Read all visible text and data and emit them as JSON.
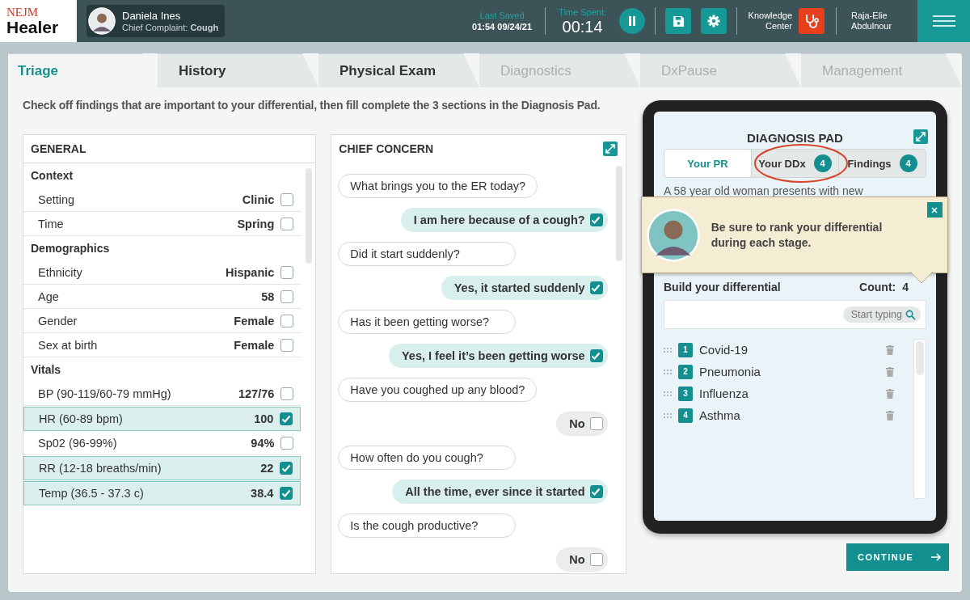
{
  "header": {
    "logo_top": "NEJM",
    "logo_bottom": "Healer",
    "patient": {
      "name": "Daniela Ines",
      "complaint": "Chief Complaint: **Cough**"
    },
    "last_saved": {
      "label": "Last Saved",
      "value": "01:54 09/24/21"
    },
    "time_spent": {
      "label": "Time Spent:",
      "value": "00:14"
    },
    "knowledge_center": "Knowledge Center",
    "user": "Raja-Elie Abdulnour"
  },
  "tabs": [
    {
      "label": "Triage",
      "selected": true,
      "disabled": false
    },
    {
      "label": "History",
      "selected": false,
      "disabled": false
    },
    {
      "label": "Physical Exam",
      "selected": false,
      "disabled": false
    },
    {
      "label": "Diagnostics",
      "selected": false,
      "disabled": true
    },
    {
      "label": "DxPause",
      "selected": false,
      "disabled": true
    },
    {
      "label": "Management",
      "selected": false,
      "disabled": true
    }
  ],
  "instruction": "Check off findings that are important to your differential, then fill complete the 3 sections in the Diagnosis Pad.",
  "general": {
    "title": "GENERAL",
    "sections": [
      {
        "title": "Context",
        "rows": [
          {
            "label": "Setting",
            "value": "Clinic",
            "checked": false
          },
          {
            "label": "Time",
            "value": "Spring",
            "checked": false
          }
        ]
      },
      {
        "title": "Demographics",
        "rows": [
          {
            "label": "Ethnicity",
            "value": "Hispanic",
            "checked": false
          },
          {
            "label": "Age",
            "value": "58",
            "checked": false
          },
          {
            "label": "Gender",
            "value": "Female",
            "checked": false
          },
          {
            "label": "Sex at birth",
            "value": "Female",
            "checked": false
          }
        ]
      },
      {
        "title": "Vitals",
        "rows": [
          {
            "label": "BP (90-119/60-79 mmHg)",
            "value": "127/76",
            "checked": false
          },
          {
            "label": "HR (60-89 bpm)",
            "value": "100",
            "checked": true
          },
          {
            "label": "Sp02 (96-99%)",
            "value": "94%",
            "checked": false
          },
          {
            "label": "RR (12-18 breaths/min)",
            "value": "22",
            "checked": true
          },
          {
            "label": "Temp (36.5 - 37.3 c)",
            "value": "38.4",
            "checked": true
          }
        ]
      }
    ]
  },
  "chief_concern": {
    "title": "CHIEF CONCERN",
    "messages": [
      {
        "kind": "question",
        "text": "What brings you to the ER today?"
      },
      {
        "kind": "answer",
        "text": "I am here because of a cough?",
        "checked": true
      },
      {
        "kind": "question",
        "text": "Did it start suddenly?"
      },
      {
        "kind": "answer",
        "text": "Yes, it started suddenly",
        "checked": true
      },
      {
        "kind": "question",
        "text": "Has it been getting worse?"
      },
      {
        "kind": "answer",
        "text": "Yes, I feel it’s been getting worse",
        "checked": true
      },
      {
        "kind": "question",
        "text": "Have you coughed up any blood?"
      },
      {
        "kind": "answer",
        "text": "No",
        "checked": false
      },
      {
        "kind": "question",
        "text": "How often do you cough?"
      },
      {
        "kind": "answer",
        "text": "All the time, ever since it started",
        "checked": true
      },
      {
        "kind": "question",
        "text": "Is the cough productive?"
      },
      {
        "kind": "answer",
        "text": "No",
        "checked": false
      }
    ]
  },
  "diagnosis_pad": {
    "title": "DIAGNOSIS PAD",
    "tabs": [
      {
        "label": "Your PR",
        "selected": true,
        "circled": false
      },
      {
        "label": "Your DDx",
        "count": "4",
        "selected": false,
        "circled": true
      },
      {
        "label": "Findings",
        "count": "4",
        "selected": false,
        "circled": false
      }
    ],
    "summary": "A 58 year old woman presents with new",
    "tooltip": "Be sure to rank your differential during each stage.",
    "builder_title": "Build your differential",
    "count_label": "Count:",
    "count": "4",
    "search_placeholder": "Start typing",
    "diagnoses": [
      {
        "number": "1",
        "name": "Covid-19"
      },
      {
        "number": "2",
        "name": "Pneumonia"
      },
      {
        "number": "3",
        "name": "Influenza"
      },
      {
        "number": "4",
        "name": "Asthma"
      }
    ]
  },
  "continue_button": "CONTINUE"
}
